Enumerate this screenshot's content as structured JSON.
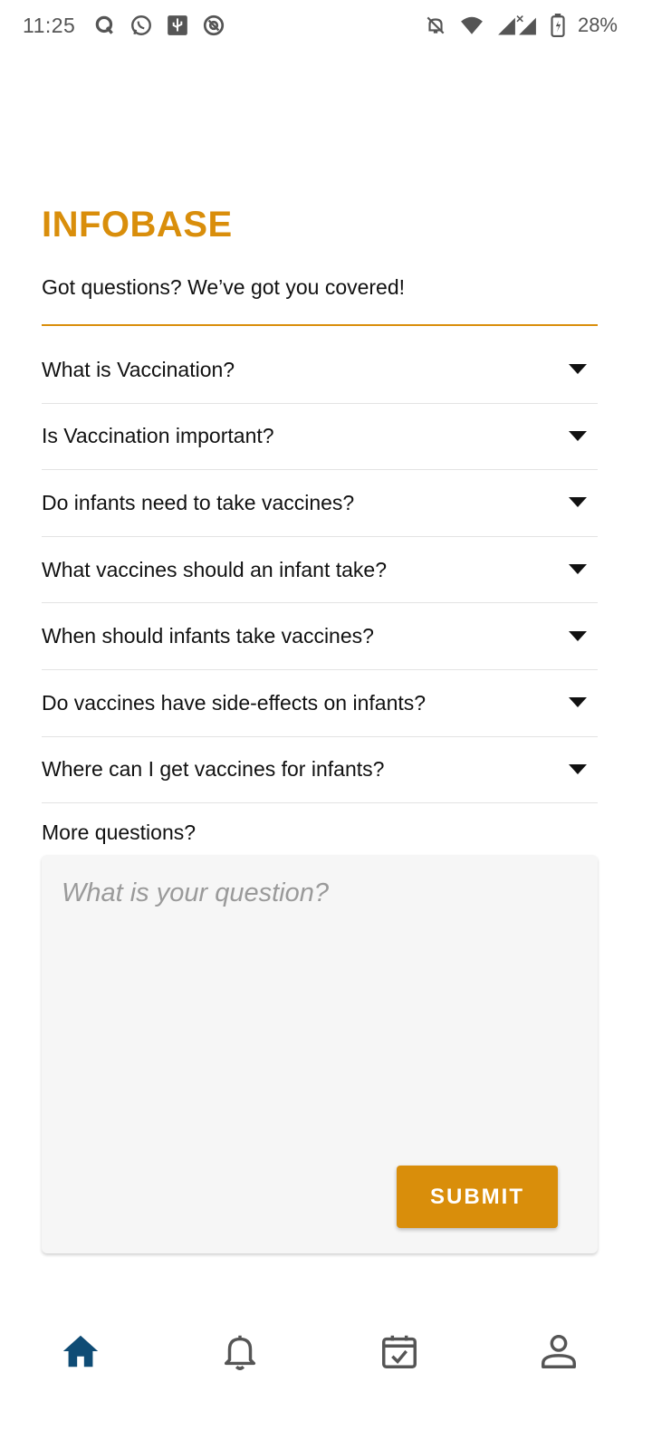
{
  "status_bar": {
    "time": "11:25",
    "battery": "28%",
    "left_icons": [
      "quora-icon",
      "whatsapp-icon",
      "usb-debug-icon",
      "at-sign-icon"
    ],
    "right_icons": [
      "notifications-off-icon",
      "wifi-icon",
      "signal-icon",
      "battery-charging-icon"
    ]
  },
  "header": {
    "title": "INFOBASE",
    "subtitle": "Got questions? We’ve got you covered!"
  },
  "faq": {
    "items": [
      {
        "label": "What is Vaccination?"
      },
      {
        "label": "Is Vaccination important?"
      },
      {
        "label": "Do infants need to take vaccines?"
      },
      {
        "label": "What vaccines should an infant take?"
      },
      {
        "label": "When should infants take vaccines?"
      },
      {
        "label": "Do vaccines have side-effects on infants?"
      },
      {
        "label": "Where can I get vaccines for infants?"
      }
    ]
  },
  "question_form": {
    "label": "More questions?",
    "placeholder": "What is your question?",
    "value": "",
    "submit_label": "SUBMIT"
  },
  "bottom_nav": {
    "items": [
      {
        "icon": "home-icon",
        "active": true
      },
      {
        "icon": "bell-icon",
        "active": false
      },
      {
        "icon": "calendar-check-icon",
        "active": false
      },
      {
        "icon": "profile-icon",
        "active": false
      }
    ]
  },
  "colors": {
    "accent": "#D98E0B",
    "nav_active": "#0F4C75",
    "nav_inactive": "#555555",
    "input_bg": "#F6F6F6"
  }
}
